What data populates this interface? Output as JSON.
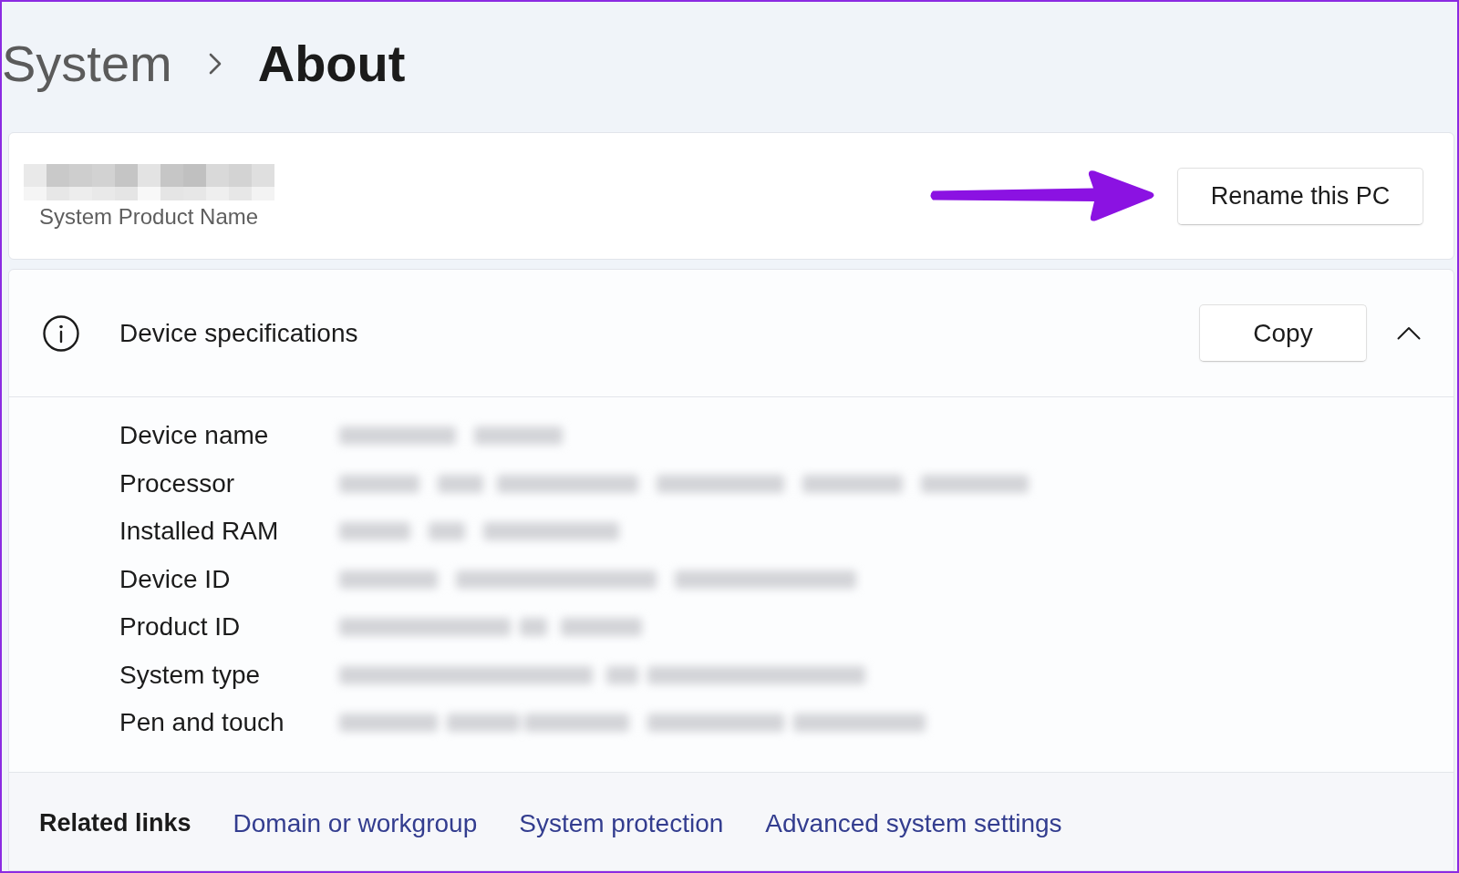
{
  "breadcrumb": [
    {
      "label": "System",
      "current": false
    },
    {
      "label": "About",
      "current": true
    }
  ],
  "device": {
    "subtitle": "System Product Name",
    "rename_button": "Rename this PC"
  },
  "specifications": {
    "title": "Device specifications",
    "copy_button": "Copy",
    "expanded": true,
    "rows": [
      {
        "label": "Device name"
      },
      {
        "label": "Processor"
      },
      {
        "label": "Installed RAM"
      },
      {
        "label": "Device ID"
      },
      {
        "label": "Product ID"
      },
      {
        "label": "System type"
      },
      {
        "label": "Pen and touch"
      }
    ]
  },
  "related_links": {
    "title": "Related links",
    "links": [
      {
        "label": "Domain or workgroup"
      },
      {
        "label": "System protection"
      },
      {
        "label": "Advanced system settings"
      }
    ]
  }
}
